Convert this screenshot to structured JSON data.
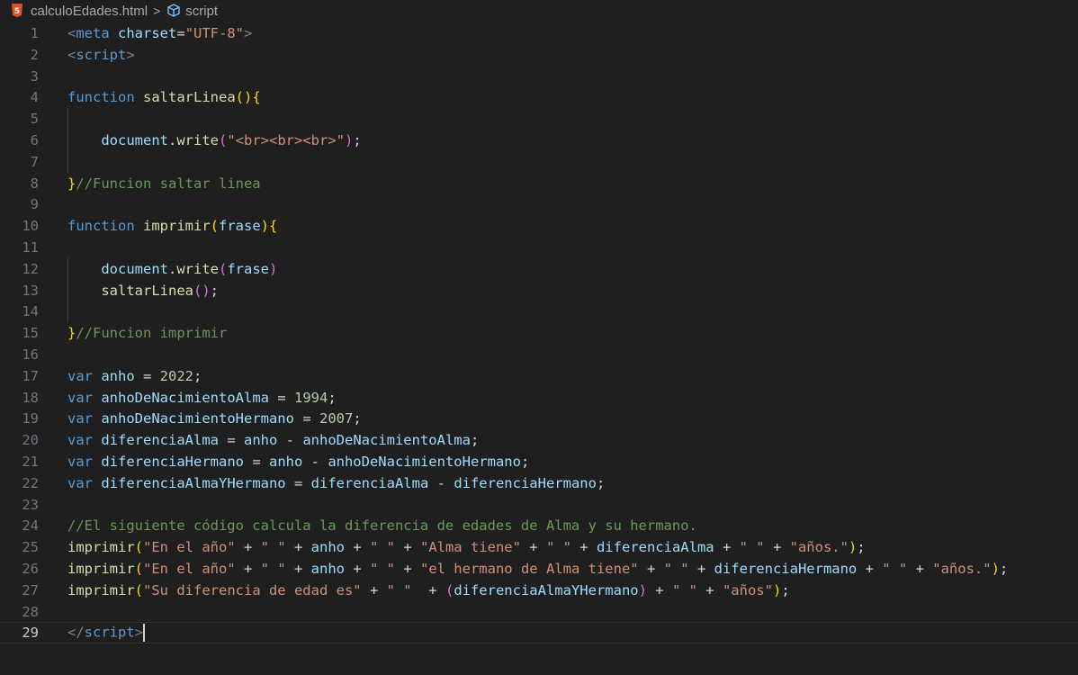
{
  "breadcrumb": {
    "file": "calculoEdades.html",
    "separator": ">",
    "symbol": "script",
    "file_icon": "html5-icon",
    "symbol_icon": "cube-icon"
  },
  "editor": {
    "current_line": 29,
    "lines": [
      {
        "n": "1",
        "t": [
          [
            "tagp",
            "<"
          ],
          [
            "tag",
            "meta"
          ],
          [
            "op",
            " "
          ],
          [
            "attr",
            "charset"
          ],
          [
            "op",
            "="
          ],
          [
            "str",
            "\"UTF-8\""
          ],
          [
            "tagp",
            ">"
          ]
        ]
      },
      {
        "n": "2",
        "t": [
          [
            "tagp",
            "<"
          ],
          [
            "tag",
            "script"
          ],
          [
            "tagp",
            ">"
          ]
        ]
      },
      {
        "n": "3",
        "t": []
      },
      {
        "n": "4",
        "t": [
          [
            "kw",
            "function"
          ],
          [
            "op",
            " "
          ],
          [
            "fn",
            "saltarLinea"
          ],
          [
            "br1",
            "()"
          ],
          [
            "br1",
            "{"
          ]
        ]
      },
      {
        "n": "5",
        "t": []
      },
      {
        "n": "6",
        "t": [
          [
            "op",
            "    "
          ],
          [
            "var",
            "document"
          ],
          [
            "op",
            "."
          ],
          [
            "fn",
            "write"
          ],
          [
            "br2",
            "("
          ],
          [
            "str",
            "\"<br><br><br>\""
          ],
          [
            "br2",
            ")"
          ],
          [
            "op",
            ";"
          ]
        ]
      },
      {
        "n": "7",
        "t": []
      },
      {
        "n": "8",
        "t": [
          [
            "br1",
            "}"
          ],
          [
            "cmt",
            "//Funcion saltar linea"
          ]
        ]
      },
      {
        "n": "9",
        "t": []
      },
      {
        "n": "10",
        "t": [
          [
            "kw",
            "function"
          ],
          [
            "op",
            " "
          ],
          [
            "fn",
            "imprimir"
          ],
          [
            "br1",
            "("
          ],
          [
            "var",
            "frase"
          ],
          [
            "br1",
            ")"
          ],
          [
            "br1",
            "{"
          ]
        ]
      },
      {
        "n": "11",
        "t": []
      },
      {
        "n": "12",
        "t": [
          [
            "op",
            "    "
          ],
          [
            "var",
            "document"
          ],
          [
            "op",
            "."
          ],
          [
            "fn",
            "write"
          ],
          [
            "br2",
            "("
          ],
          [
            "var",
            "frase"
          ],
          [
            "br2",
            ")"
          ]
        ]
      },
      {
        "n": "13",
        "t": [
          [
            "op",
            "    "
          ],
          [
            "fn",
            "saltarLinea"
          ],
          [
            "br2",
            "()"
          ],
          [
            "op",
            ";"
          ]
        ]
      },
      {
        "n": "14",
        "t": []
      },
      {
        "n": "15",
        "t": [
          [
            "br1",
            "}"
          ],
          [
            "cmt",
            "//Funcion imprimir"
          ]
        ]
      },
      {
        "n": "16",
        "t": []
      },
      {
        "n": "17",
        "t": [
          [
            "kw",
            "var"
          ],
          [
            "op",
            " "
          ],
          [
            "var",
            "anho"
          ],
          [
            "op",
            " = "
          ],
          [
            "num",
            "2022"
          ],
          [
            "op",
            ";"
          ]
        ]
      },
      {
        "n": "18",
        "t": [
          [
            "kw",
            "var"
          ],
          [
            "op",
            " "
          ],
          [
            "var",
            "anhoDeNacimientoAlma"
          ],
          [
            "op",
            " = "
          ],
          [
            "num",
            "1994"
          ],
          [
            "op",
            ";"
          ]
        ]
      },
      {
        "n": "19",
        "t": [
          [
            "kw",
            "var"
          ],
          [
            "op",
            " "
          ],
          [
            "var",
            "anhoDeNacimientoHermano"
          ],
          [
            "op",
            " = "
          ],
          [
            "num",
            "2007"
          ],
          [
            "op",
            ";"
          ]
        ]
      },
      {
        "n": "20",
        "t": [
          [
            "kw",
            "var"
          ],
          [
            "op",
            " "
          ],
          [
            "var",
            "diferenciaAlma"
          ],
          [
            "op",
            " = "
          ],
          [
            "var",
            "anho"
          ],
          [
            "op",
            " - "
          ],
          [
            "var",
            "anhoDeNacimientoAlma"
          ],
          [
            "op",
            ";"
          ]
        ]
      },
      {
        "n": "21",
        "t": [
          [
            "kw",
            "var"
          ],
          [
            "op",
            " "
          ],
          [
            "var",
            "diferenciaHermano"
          ],
          [
            "op",
            " = "
          ],
          [
            "var",
            "anho"
          ],
          [
            "op",
            " - "
          ],
          [
            "var",
            "anhoDeNacimientoHermano"
          ],
          [
            "op",
            ";"
          ]
        ]
      },
      {
        "n": "22",
        "t": [
          [
            "kw",
            "var"
          ],
          [
            "op",
            " "
          ],
          [
            "var",
            "diferenciaAlmaYHermano"
          ],
          [
            "op",
            " = "
          ],
          [
            "var",
            "diferenciaAlma"
          ],
          [
            "op",
            " - "
          ],
          [
            "var",
            "diferenciaHermano"
          ],
          [
            "op",
            ";"
          ]
        ]
      },
      {
        "n": "23",
        "t": []
      },
      {
        "n": "24",
        "t": [
          [
            "cmt",
            "//El siguiente código calcula la diferencia de edades de Alma y su hermano."
          ]
        ]
      },
      {
        "n": "25",
        "t": [
          [
            "fn",
            "imprimir"
          ],
          [
            "br1",
            "("
          ],
          [
            "str",
            "\"En el año\""
          ],
          [
            "op",
            " + "
          ],
          [
            "str",
            "\" \""
          ],
          [
            "op",
            " + "
          ],
          [
            "var",
            "anho"
          ],
          [
            "op",
            " + "
          ],
          [
            "str",
            "\" \""
          ],
          [
            "op",
            " + "
          ],
          [
            "str",
            "\"Alma tiene\""
          ],
          [
            "op",
            " + "
          ],
          [
            "str",
            "\" \""
          ],
          [
            "op",
            " + "
          ],
          [
            "var",
            "diferenciaAlma"
          ],
          [
            "op",
            " + "
          ],
          [
            "str",
            "\" \""
          ],
          [
            "op",
            " + "
          ],
          [
            "str",
            "\"años.\""
          ],
          [
            "br1",
            ")"
          ],
          [
            "op",
            ";"
          ]
        ]
      },
      {
        "n": "26",
        "t": [
          [
            "fn",
            "imprimir"
          ],
          [
            "br1",
            "("
          ],
          [
            "str",
            "\"En el año\""
          ],
          [
            "op",
            " + "
          ],
          [
            "str",
            "\" \""
          ],
          [
            "op",
            " + "
          ],
          [
            "var",
            "anho"
          ],
          [
            "op",
            " + "
          ],
          [
            "str",
            "\" \""
          ],
          [
            "op",
            " + "
          ],
          [
            "str",
            "\"el hermano de Alma tiene\""
          ],
          [
            "op",
            " + "
          ],
          [
            "str",
            "\" \""
          ],
          [
            "op",
            " + "
          ],
          [
            "var",
            "diferenciaHermano"
          ],
          [
            "op",
            " + "
          ],
          [
            "str",
            "\" \""
          ],
          [
            "op",
            " + "
          ],
          [
            "str",
            "\"años.\""
          ],
          [
            "br1",
            ")"
          ],
          [
            "op",
            ";"
          ]
        ]
      },
      {
        "n": "27",
        "t": [
          [
            "fn",
            "imprimir"
          ],
          [
            "br1",
            "("
          ],
          [
            "str",
            "\"Su diferencia de edad es\""
          ],
          [
            "op",
            " + "
          ],
          [
            "str",
            "\" \""
          ],
          [
            "op",
            "  + "
          ],
          [
            "br2",
            "("
          ],
          [
            "var",
            "diferenciaAlmaYHermano"
          ],
          [
            "br2",
            ")"
          ],
          [
            "op",
            " + "
          ],
          [
            "str",
            "\" \""
          ],
          [
            "op",
            " + "
          ],
          [
            "str",
            "\"años\""
          ],
          [
            "br1",
            ")"
          ],
          [
            "op",
            ";"
          ]
        ]
      },
      {
        "n": "28",
        "t": []
      },
      {
        "n": "29",
        "t": [
          [
            "tagp",
            "</"
          ],
          [
            "tag",
            "script"
          ],
          [
            "tagp",
            ">"
          ]
        ]
      }
    ]
  }
}
